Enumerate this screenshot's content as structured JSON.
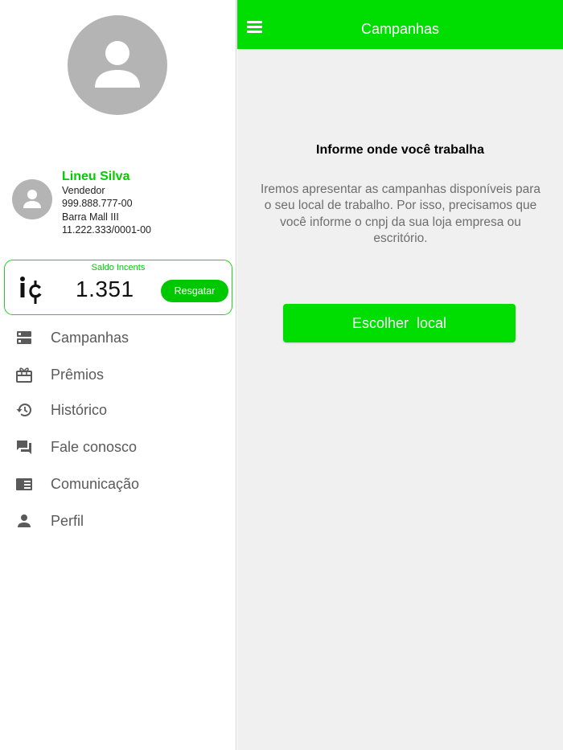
{
  "user": {
    "name": "Lineu Silva",
    "role": "Vendedor",
    "phone": "999.888.777-00",
    "store": "Barra Mall III",
    "cnpj": "11.222.333/0001-00"
  },
  "balance": {
    "title": "Saldo Incents",
    "value": "1.351",
    "redeem_label": "Resgatar",
    "coin_icon": "incents-coin-icon"
  },
  "menu": {
    "items": [
      {
        "label": "Campanhas",
        "icon": "campaigns-icon"
      },
      {
        "label": "Prêmios",
        "icon": "gift-icon"
      },
      {
        "label": "Histórico",
        "icon": "history-icon"
      },
      {
        "label": "Fale conosco",
        "icon": "chat-icon"
      },
      {
        "label": "Comunicação",
        "icon": "news-icon"
      },
      {
        "label": "Perfil",
        "icon": "person-icon"
      }
    ]
  },
  "appbar": {
    "title": "Campanhas",
    "menu_icon": "hamburger-icon"
  },
  "main": {
    "info_title": "Informe onde você trabalha",
    "info_text": "Iremos apresentar as campanhas disponíveis para o seu local de trabalho. Por isso, precisamos que você informe o cnpj da sua loja empresa ou escritório.",
    "choose_button_label": "Escolher  local"
  },
  "colors": {
    "accent_green": "#00dd00",
    "name_green": "#00cc00",
    "avatar_gray": "#b4b4b4",
    "menu_text": "#5a5a5a",
    "main_bg": "#f0f0f0"
  }
}
